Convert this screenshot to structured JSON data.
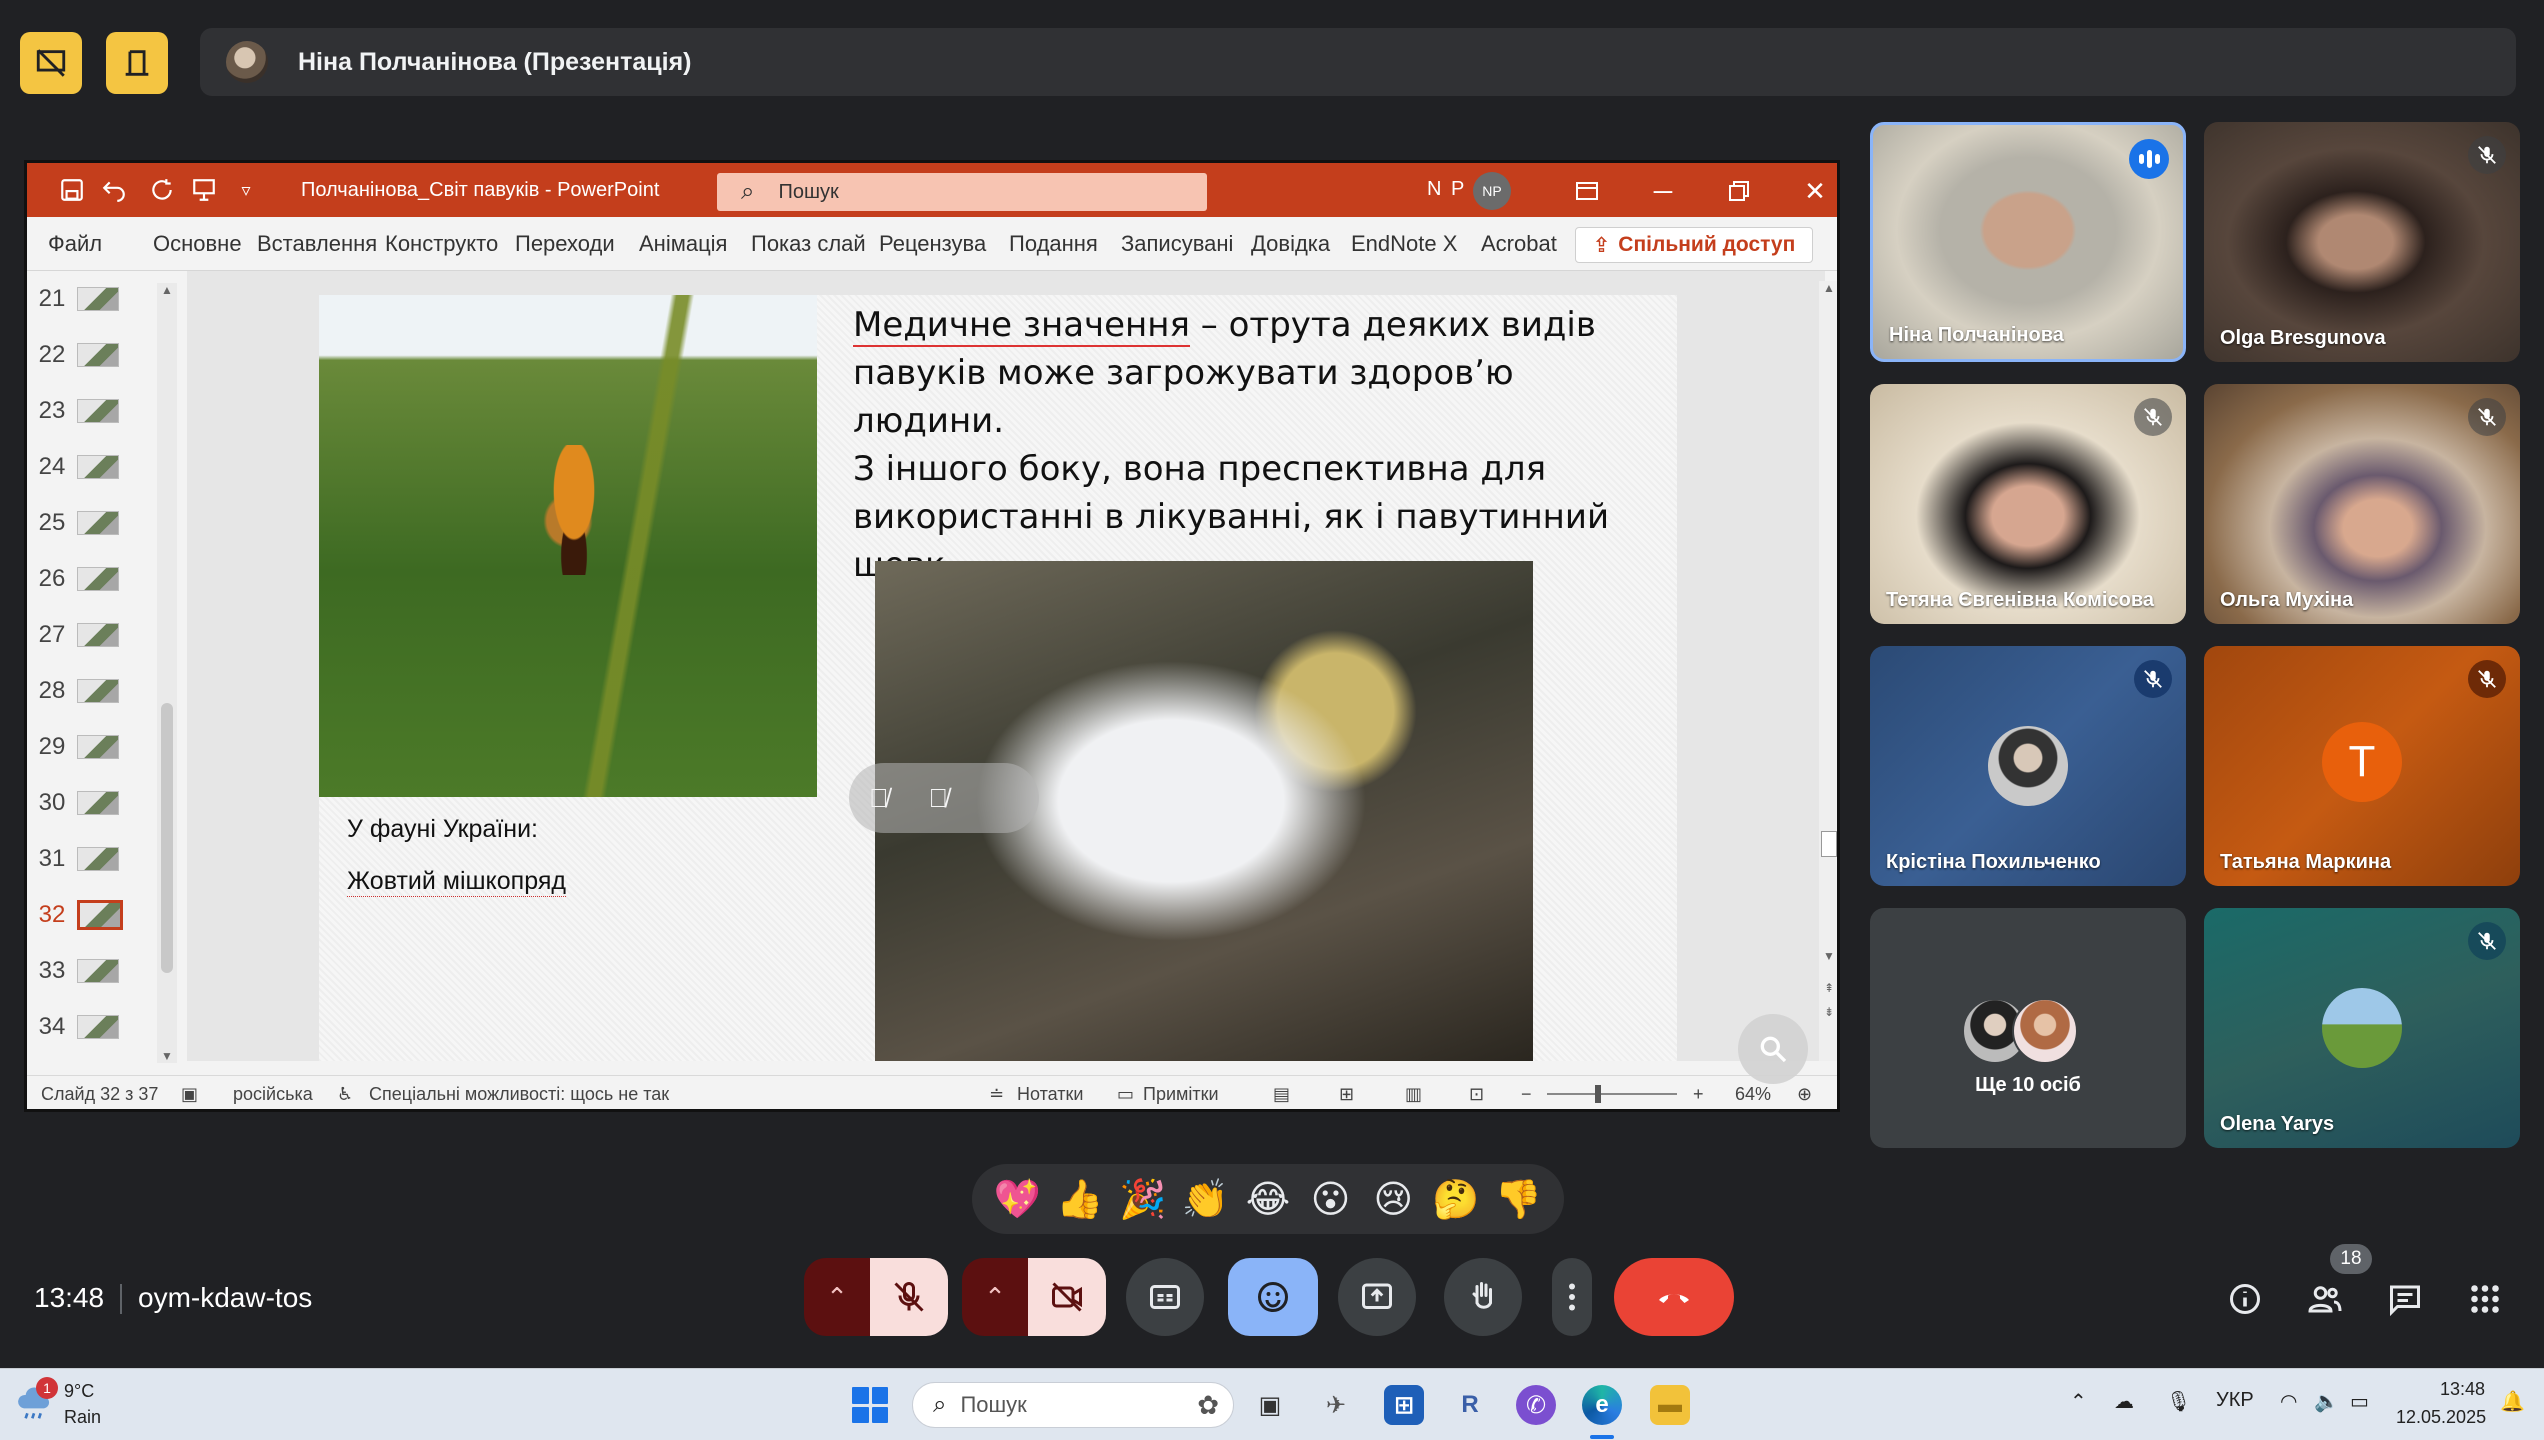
{
  "presenter_bar": {
    "name": "Ніна Полчанінова (Презентація)"
  },
  "powerpoint": {
    "doc_title": "Полчанінова_Світ павуків  -  PowerPoint",
    "search_placeholder": "Пошук",
    "user_initials": "N P",
    "avatar_initials": "NP",
    "ribbon_tabs": [
      "Файл",
      "Основне",
      "Вставлення",
      "Конструкто",
      "Переходи",
      "Анімація",
      "Показ слай",
      "Рецензува",
      "Подання",
      "Записувані",
      "Довідка",
      "EndNote X",
      "Acrobat"
    ],
    "share_label": "Спільний доступ",
    "thumbnails": [
      "21",
      "22",
      "23",
      "24",
      "25",
      "26",
      "27",
      "28",
      "29",
      "30",
      "31",
      "32",
      "33",
      "34"
    ],
    "active_slide": "32",
    "slide": {
      "heading_l1a": "Медичне значення",
      "heading_l1b": " – отрута деяких видів",
      "heading_l2": "павуків може загрожувати здоров’ю людини.",
      "heading_l3": "З іншого боку, вона преспективна для",
      "heading_l4": "використанні в лікуванні, як і павутинний",
      "heading_l5": "шовк.",
      "text1": "У фауні України:",
      "text2": "Жовтий мішкопряд"
    },
    "status": {
      "slide_of": "Слайд 32 з 37",
      "language": "російська",
      "accessibility": "Спеціальні можливості: щось не так",
      "notes": "Нотатки",
      "comments": "Примітки",
      "zoom": "64%"
    }
  },
  "participants": [
    {
      "name": "Ніна Полчанінова",
      "state": "speaking"
    },
    {
      "name": "Olga Bresgunova",
      "state": "muted"
    },
    {
      "name": "Тетяна Євгенівна Комісова",
      "state": "muted"
    },
    {
      "name": "Ольга Мухіна",
      "state": "muted"
    },
    {
      "name": "Крістіна Похильченко",
      "state": "muted"
    },
    {
      "name": "Татьяна Маркина",
      "state": "muted",
      "initial": "T"
    },
    {
      "name": "Ще 10 осіб",
      "state": "group"
    },
    {
      "name": "Olena Yarys",
      "state": "muted"
    }
  ],
  "reactions": [
    "💖",
    "👍",
    "🎉",
    "👏",
    "😂",
    "😮",
    "😢",
    "🤔",
    "👎"
  ],
  "meeting": {
    "time": "13:48",
    "code": "oym-kdaw-tos",
    "participant_count": "18"
  },
  "taskbar": {
    "weather_badge": "1",
    "temperature": "9°C",
    "weather": "Rain",
    "search_placeholder": "Пошук",
    "language": "УКР",
    "time": "13:48",
    "date": "12.05.2025"
  },
  "colors": {
    "ppt_accent": "#c43e1c",
    "meet_bg": "#202124",
    "hangup": "#ea4335",
    "active_blue": "#8ab4f8"
  }
}
